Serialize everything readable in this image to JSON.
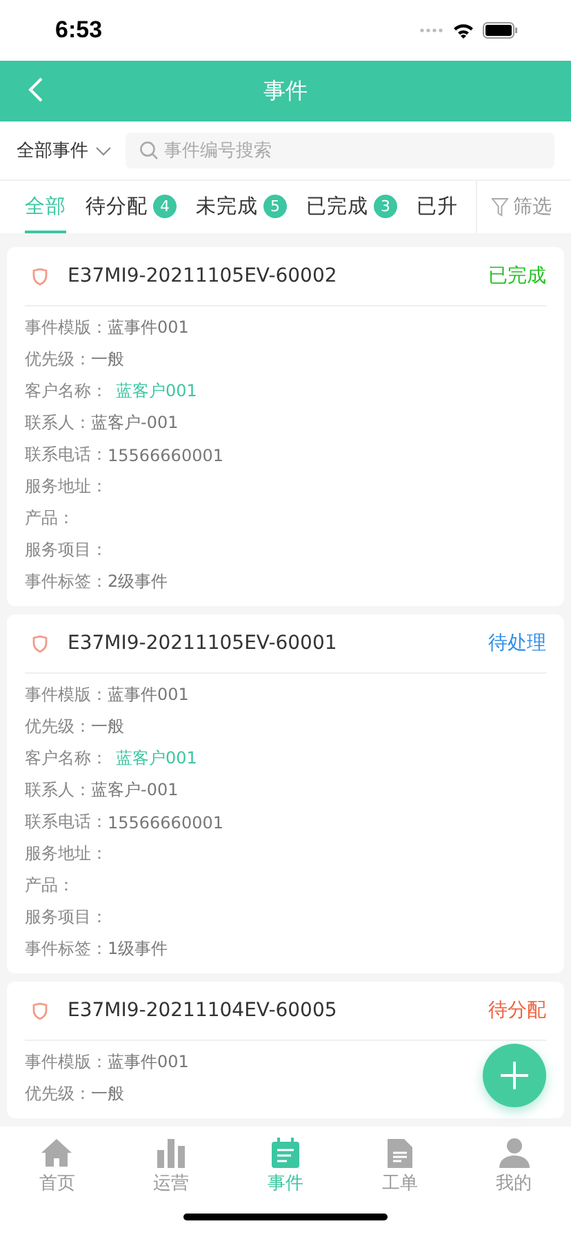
{
  "status_bar": {
    "time": "6:53"
  },
  "header": {
    "title": "事件"
  },
  "filter_bar": {
    "dropdown": "全部事件",
    "search": {
      "placeholder": "事件编号搜索"
    }
  },
  "tabs": [
    {
      "label": "全部",
      "selected": true
    },
    {
      "label": "待分配",
      "badge": "4",
      "selected": false
    },
    {
      "label": "未完成",
      "badge": "5",
      "selected": false
    },
    {
      "label": "已完成",
      "badge": "3",
      "selected": false
    },
    {
      "label": "已升",
      "selected": false
    }
  ],
  "filter_button": "筛选",
  "events": [
    {
      "number": "E37MI9-20211105EV-60002",
      "status": "已完成",
      "color": "#22c322",
      "fields": [
        {
          "label": "事件模版：",
          "value": "蓝事件001",
          "kind": "text"
        },
        {
          "label": "优先级：",
          "value": "一般",
          "kind": "text"
        },
        {
          "label": "客户名称：",
          "value": "蓝客户001",
          "kind": "link"
        },
        {
          "label": "联系人：",
          "value": "蓝客户-001",
          "kind": "text"
        },
        {
          "label": "联系电话：",
          "value": "15566660001",
          "kind": "text"
        },
        {
          "label": "服务地址："
        },
        {
          "label": "产品："
        },
        {
          "label": "服务项目："
        },
        {
          "label": "事件标签：",
          "value": "2级事件",
          "kind": "text"
        }
      ]
    },
    {
      "number": "E37MI9-20211105EV-60001",
      "status": "待处理",
      "color": "#2f8fe8",
      "fields": [
        {
          "label": "事件模版：",
          "value": "蓝事件001",
          "kind": "text"
        },
        {
          "label": "优先级：",
          "value": "一般",
          "kind": "text"
        },
        {
          "label": "客户名称：",
          "value": "蓝客户001",
          "kind": "link"
        },
        {
          "label": "联系人：",
          "value": "蓝客户-001",
          "kind": "text"
        },
        {
          "label": "联系电话：",
          "value": "15566660001",
          "kind": "text"
        },
        {
          "label": "服务地址："
        },
        {
          "label": "产品："
        },
        {
          "label": "服务项目："
        },
        {
          "label": "事件标签：",
          "value": "1级事件",
          "kind": "text"
        }
      ]
    },
    {
      "number": "E37MI9-20211104EV-60005",
      "status": "待分配",
      "color": "#f0603c",
      "fields": [
        {
          "label": "事件模版：",
          "value": "蓝事件001",
          "kind": "text"
        },
        {
          "label": "优先级：",
          "value": "一般",
          "kind": "text"
        }
      ]
    }
  ],
  "bottom_nav": [
    {
      "label": "首页",
      "kind": "home",
      "selected": false
    },
    {
      "label": "运营",
      "kind": "chart",
      "selected": false
    },
    {
      "label": "事件",
      "kind": "calendar",
      "selected": true
    },
    {
      "label": "工单",
      "kind": "document",
      "selected": false
    },
    {
      "label": "我的",
      "kind": "person",
      "selected": false
    }
  ]
}
